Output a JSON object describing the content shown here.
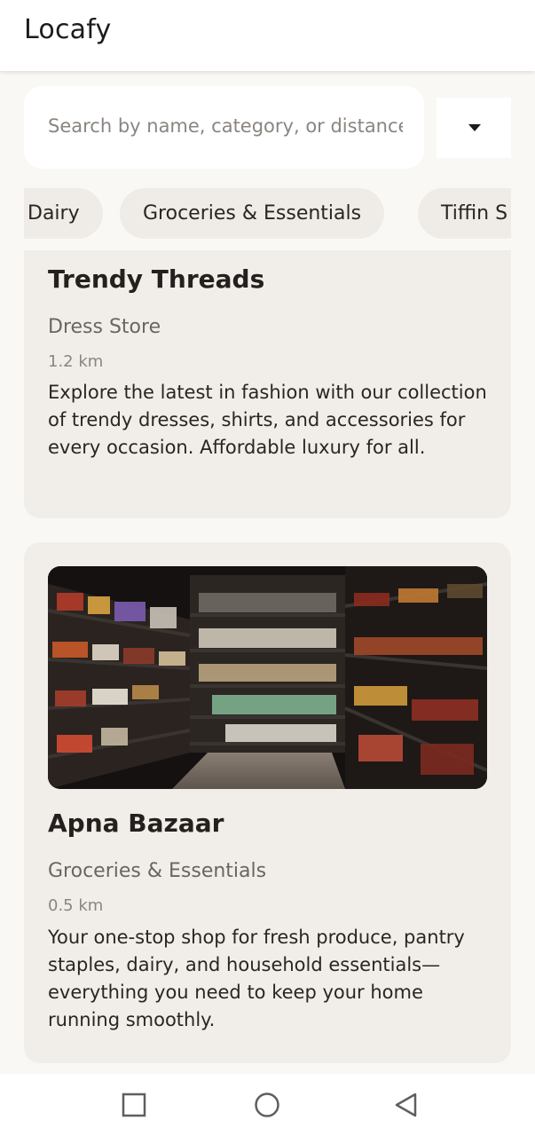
{
  "app": {
    "title": "Locafy"
  },
  "search": {
    "placeholder": "Search by name, category, or distance"
  },
  "filter": {
    "icon": "chevron-down-icon"
  },
  "categories": [
    {
      "label": "Dairy"
    },
    {
      "label": "Groceries & Essentials"
    },
    {
      "label": "Tiffin S"
    }
  ],
  "stores": [
    {
      "name": "Trendy Threads",
      "category": "Dress Store",
      "distance": "1.2 km",
      "description": "Explore the latest in fashion with our collection of trendy dresses, shirts, and accessories for every occasion. Affordable luxury for all."
    },
    {
      "name": "Apna Bazaar",
      "category": "Groceries & Essentials",
      "distance": "0.5 km",
      "description": "Your one-stop shop for fresh produce, pantry staples, dairy, and household essentials—everything you need to keep your home running smoothly."
    }
  ],
  "navigation": {
    "recents_icon": "square-icon",
    "home_icon": "circle-icon",
    "back_icon": "triangle-back-icon"
  },
  "colors": {
    "background": "#faf8f5",
    "card": "#f1eeea",
    "chip": "#efebe6",
    "text_primary": "#25201d",
    "text_secondary": "#6b6560"
  }
}
